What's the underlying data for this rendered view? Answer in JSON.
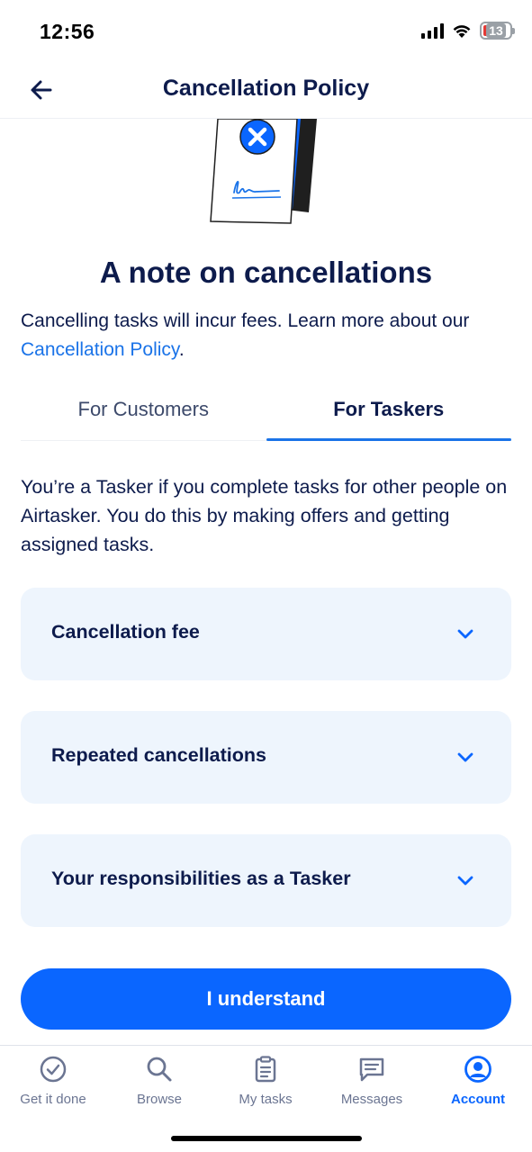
{
  "status": {
    "time": "12:56",
    "battery": "13"
  },
  "header": {
    "title": "Cancellation Policy"
  },
  "hero": {
    "title": "A note on cancellations",
    "intro_text": "Cancelling tasks will incur fees. Learn more about our ",
    "intro_link": "Cancellation Policy",
    "intro_end": "."
  },
  "tabs": [
    {
      "label": "For Customers",
      "active": false
    },
    {
      "label": "For Taskers",
      "active": true
    }
  ],
  "tasker_description": "You’re a Tasker if you complete tasks for other people on Airtasker. You do this by making offers and getting assigned tasks.",
  "accordions": [
    {
      "label": "Cancellation fee",
      "icon": "chevron-down-icon"
    },
    {
      "label": "Repeated cancellations",
      "icon": "chevron-down-icon"
    },
    {
      "label": "Your responsibilities as a Tasker",
      "icon": "chevron-down-icon"
    }
  ],
  "primary_button": {
    "label": "I understand"
  },
  "bottom_nav": [
    {
      "label": "Get it done",
      "icon": "check-circle-icon",
      "active": false
    },
    {
      "label": "Browse",
      "icon": "search-icon",
      "active": false
    },
    {
      "label": "My tasks",
      "icon": "clipboard-icon",
      "active": false
    },
    {
      "label": "Messages",
      "icon": "message-icon",
      "active": false
    },
    {
      "label": "Account",
      "icon": "account-icon",
      "active": true
    }
  ],
  "colors": {
    "primary": "#0a66ff",
    "link": "#1a73e8",
    "text": "#0d1b4c",
    "card_background": "#eef5fd"
  }
}
